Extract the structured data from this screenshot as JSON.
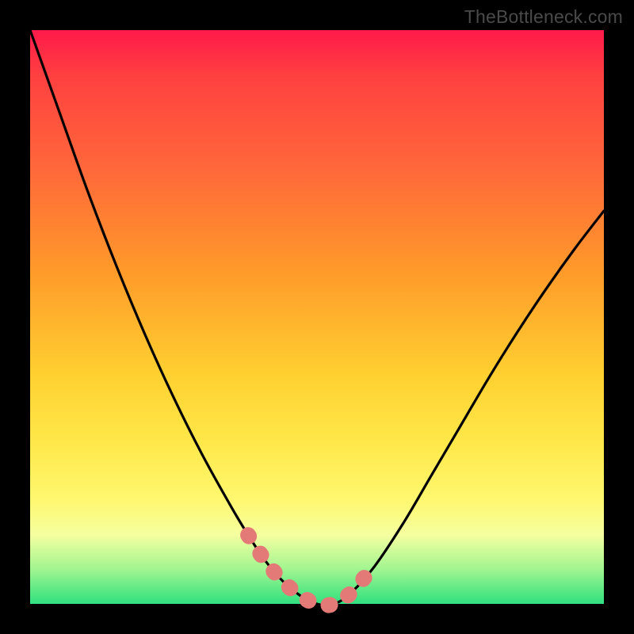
{
  "watermark": "TheBottleneck.com",
  "chart_data": {
    "type": "line",
    "title": "",
    "xlabel": "",
    "ylabel": "",
    "xlim": [
      0,
      1
    ],
    "ylim": [
      0,
      1
    ],
    "series": [
      {
        "name": "main-curve",
        "x": [
          0.0,
          0.05,
          0.1,
          0.15,
          0.2,
          0.25,
          0.3,
          0.35,
          0.38,
          0.41,
          0.44,
          0.47,
          0.5,
          0.53,
          0.56,
          0.6,
          0.65,
          0.7,
          0.75,
          0.8,
          0.85,
          0.9,
          0.95,
          1.0
        ],
        "y": [
          1.0,
          0.86,
          0.72,
          0.59,
          0.47,
          0.36,
          0.26,
          0.17,
          0.12,
          0.075,
          0.04,
          0.015,
          0.0,
          0.0,
          0.02,
          0.065,
          0.14,
          0.225,
          0.31,
          0.395,
          0.475,
          0.55,
          0.62,
          0.685
        ]
      },
      {
        "name": "highlight-segment",
        "x": [
          0.38,
          0.41,
          0.44,
          0.47,
          0.5,
          0.53,
          0.56,
          0.59
        ],
        "y": [
          0.12,
          0.075,
          0.04,
          0.015,
          0.0,
          0.0,
          0.02,
          0.055
        ]
      }
    ],
    "colors": {
      "main_curve": "#000000",
      "highlight": "#e37a78"
    }
  }
}
